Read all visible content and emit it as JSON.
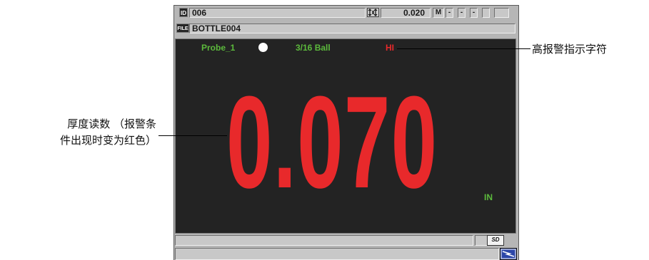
{
  "device": {
    "id_tag": "ID",
    "id_value": "006",
    "cal_icon": "dual-arrow-cal-icon",
    "thickness_ref": "0.020",
    "mode_box": "M",
    "box_1": "-",
    "box_2": "-",
    "box_3": "-",
    "file_tag": "FILE",
    "file_value": "BOTTLE004"
  },
  "screen": {
    "probe_name": "Probe_1",
    "probe_tip": "3/16 Ball",
    "alarm_indicator": "HI",
    "reading": "0.070",
    "unit": "IN",
    "reading_color": "#e8292b",
    "label_color": "#5cba3c"
  },
  "footer": {
    "sd_label": "SD",
    "power_icon": "lightning-power-icon"
  },
  "annotations": {
    "left_line1": "厚度读数 （报警条",
    "left_line2": "件出现时变为红色）",
    "right": "高报警指示字符"
  }
}
